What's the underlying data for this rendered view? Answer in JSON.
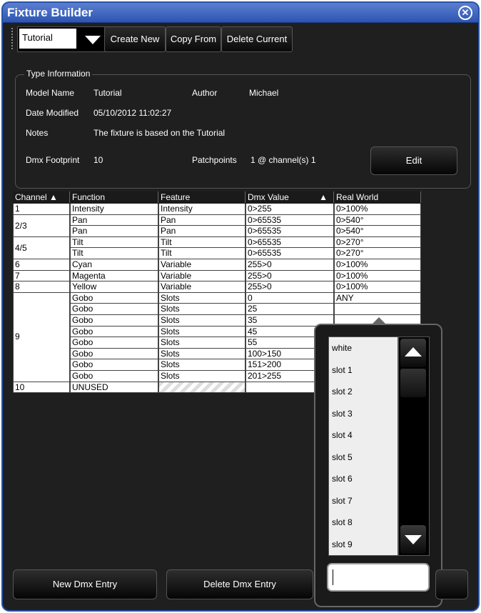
{
  "window": {
    "title": "Fixture Builder"
  },
  "toolbar": {
    "selected_type": "Tutorial",
    "create_new": "Create New",
    "copy_from": "Copy From",
    "delete_current": "Delete Current"
  },
  "type_info": {
    "group_title": "Type Information",
    "model_name_label": "Model Name",
    "model_name_value": "Tutorial",
    "author_label": "Author",
    "author_value": "Michael",
    "date_modified_label": "Date Modified",
    "date_modified_value": "05/10/2012 11:02:27",
    "notes_label": "Notes",
    "notes_value": "The fixture is based on the Tutorial",
    "dmx_footprint_label": "Dmx Footprint",
    "dmx_footprint_value": "10",
    "patchpoints_label": "Patchpoints",
    "patchpoints_value": "1 @ channel(s) 1",
    "edit_button": "Edit"
  },
  "table": {
    "headers": [
      "Channel ▲",
      "Function",
      "Feature",
      "Dmx Value",
      "Real World"
    ],
    "dmx_sort_icon": "▲",
    "channels": [
      {
        "label": "1",
        "start": 0,
        "span": 1
      },
      {
        "label": "2/3",
        "start": 1,
        "span": 2
      },
      {
        "label": "4/5",
        "start": 3,
        "span": 2
      },
      {
        "label": "6",
        "start": 5,
        "span": 1
      },
      {
        "label": "7",
        "start": 6,
        "span": 1
      },
      {
        "label": "8",
        "start": 7,
        "span": 1
      },
      {
        "label": "9",
        "start": 8,
        "span": 8
      },
      {
        "label": "10",
        "start": 16,
        "span": 1
      }
    ],
    "rows": [
      {
        "function": "Intensity",
        "feature": "Intensity",
        "dmx": "0>255",
        "real": "0>100%"
      },
      {
        "function": "Pan",
        "feature": "Pan",
        "dmx": "0>65535",
        "real": "0>540°"
      },
      {
        "function": "Pan",
        "feature": "Pan",
        "dmx": "0>65535",
        "real": "0>540°"
      },
      {
        "function": "Tilt",
        "feature": "Tilt",
        "dmx": "0>65535",
        "real": "0>270°"
      },
      {
        "function": "Tilt",
        "feature": "Tilt",
        "dmx": "0>65535",
        "real": "0>270°"
      },
      {
        "function": "Cyan",
        "feature": "Variable",
        "dmx": "255>0",
        "real": "0>100%"
      },
      {
        "function": "Magenta",
        "feature": "Variable",
        "dmx": "255>0",
        "real": "0>100%"
      },
      {
        "function": "Yellow",
        "feature": "Variable",
        "dmx": "255>0",
        "real": "0>100%"
      },
      {
        "function": "Gobo",
        "feature": "Slots",
        "dmx": "0",
        "real": "ANY"
      },
      {
        "function": "Gobo",
        "feature": "Slots",
        "dmx": "25",
        "real": ""
      },
      {
        "function": "Gobo",
        "feature": "Slots",
        "dmx": "35",
        "real": ""
      },
      {
        "function": "Gobo",
        "feature": "Slots",
        "dmx": "45",
        "real": ""
      },
      {
        "function": "Gobo",
        "feature": "Slots",
        "dmx": "55",
        "real": ""
      },
      {
        "function": "Gobo",
        "feature": "Slots",
        "dmx": "100>150",
        "real": ""
      },
      {
        "function": "Gobo",
        "feature": "Slots",
        "dmx": "151>200",
        "real": ""
      },
      {
        "function": "Gobo",
        "feature": "Slots",
        "dmx": "201>255",
        "real": ""
      },
      {
        "function": "UNUSED",
        "feature": "",
        "dmx": "",
        "real": ""
      }
    ]
  },
  "dropdown": {
    "options": [
      "white",
      "slot 1",
      "slot 2",
      "slot 3",
      "slot 4",
      "slot 5",
      "slot 6",
      "slot 7",
      "slot 8",
      "slot 9"
    ],
    "input_value": ""
  },
  "bottom": {
    "new_entry": "New Dmx Entry",
    "delete_entry": "Delete Dmx Entry"
  }
}
